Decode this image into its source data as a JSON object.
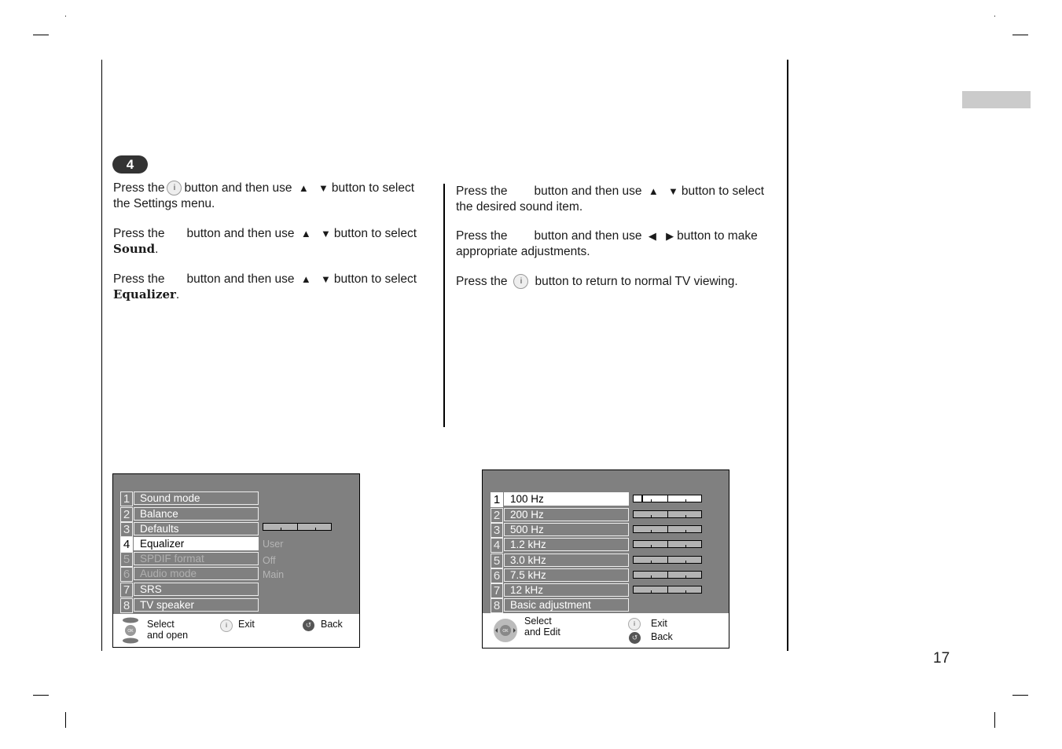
{
  "page": {
    "number": "17",
    "step_number": "4"
  },
  "left_column": {
    "paragraphs": [
      {
        "p1": "Press the",
        "icon": "i",
        "p2": "button and then use",
        "p3": "button to select",
        "line2": "the Settings menu.",
        "bold": ""
      },
      {
        "p1": "Press the",
        "p2": "button and then use",
        "p3": "button to select",
        "bold": "Sound",
        "after": "."
      },
      {
        "p1": "Press the",
        "p2": "button and then use",
        "p3": "button to select",
        "bold": "Equalizer",
        "after": "."
      }
    ]
  },
  "right_column": {
    "paragraphs": [
      {
        "p1": "Press the",
        "p2": "button and then use",
        "p3": "button to select",
        "line2": "the desired sound item."
      },
      {
        "p1": "Press the",
        "p2": "button and then use",
        "p3": "button to make",
        "line2": "appropriate adjustments."
      },
      {
        "p1": "Press the",
        "icon": "i",
        "p2": "button to return to normal TV viewing."
      }
    ]
  },
  "arrows": {
    "up": "▲",
    "down": "▼",
    "left": "◀",
    "right": "▶"
  },
  "sound_menu": {
    "items": [
      {
        "num": "1",
        "label": "Sound mode",
        "state": "normal"
      },
      {
        "num": "2",
        "label": "Balance",
        "state": "normal"
      },
      {
        "num": "3",
        "label": "Defaults",
        "state": "normal"
      },
      {
        "num": "4",
        "label": "Equalizer",
        "state": "selected"
      },
      {
        "num": "5",
        "label": "SPDIF format",
        "state": "disabled"
      },
      {
        "num": "6",
        "label": "Audio mode",
        "state": "disabled"
      },
      {
        "num": "7",
        "label": "SRS",
        "state": "normal"
      },
      {
        "num": "8",
        "label": "TV speaker",
        "state": "normal"
      }
    ],
    "values": {
      "equalizer": "User",
      "spdif": "Off",
      "audio_mode": "Main"
    },
    "footer": {
      "select": "Select",
      "select2": "and open",
      "exit": "Exit",
      "back": "Back",
      "ok": "OK",
      "i": "i"
    }
  },
  "equalizer_menu": {
    "items": [
      {
        "num": "1",
        "label": "100 Hz",
        "level": -5
      },
      {
        "num": "2",
        "label": "200 Hz",
        "level": 0
      },
      {
        "num": "3",
        "label": "500 Hz",
        "level": 0
      },
      {
        "num": "4",
        "label": "1.2 kHz",
        "level": 0
      },
      {
        "num": "5",
        "label": "3.0 kHz",
        "level": 0
      },
      {
        "num": "6",
        "label": "7.5 kHz",
        "level": 0
      },
      {
        "num": "7",
        "label": "12 kHz",
        "level": 0
      },
      {
        "num": "8",
        "label": "Basic adjustment"
      }
    ],
    "footer": {
      "select": "Select",
      "select2": "and Edit",
      "exit": "Exit",
      "back": "Back",
      "ok": "OK",
      "i": "i"
    }
  }
}
